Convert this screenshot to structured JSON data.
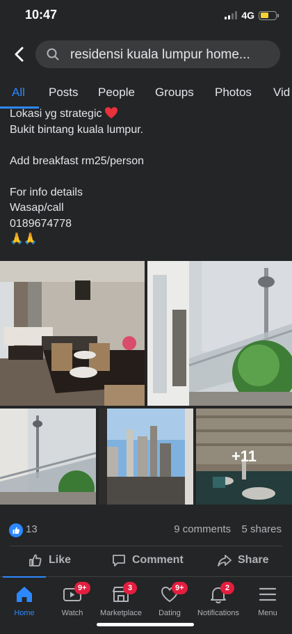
{
  "status_bar": {
    "time": "10:47",
    "network": "4G"
  },
  "search": {
    "query": "residensi kuala lumpur home..."
  },
  "tabs": [
    {
      "label": "All",
      "active": true
    },
    {
      "label": "Posts"
    },
    {
      "label": "People"
    },
    {
      "label": "Groups"
    },
    {
      "label": "Photos"
    },
    {
      "label": "Vid"
    }
  ],
  "post": {
    "lines": [
      "Lokasi yg strategic",
      "Bukit bintang kuala lumpur.",
      "",
      "Add breakfast rm25/person",
      "",
      "For info details",
      "Wasap/call",
      "0189674778",
      "🙏🙏"
    ],
    "more_photos": "+11",
    "reaction_count": "13",
    "comments": "9 comments",
    "shares": "5 shares"
  },
  "actions": {
    "like": "Like",
    "comment": "Comment",
    "share": "Share"
  },
  "bottom_nav": [
    {
      "label": "Home",
      "icon": "home-icon",
      "active": true,
      "badge": ""
    },
    {
      "label": "Watch",
      "icon": "watch-icon",
      "badge": "9+"
    },
    {
      "label": "Marketplace",
      "icon": "marketplace-icon",
      "badge": "3"
    },
    {
      "label": "Dating",
      "icon": "dating-icon",
      "badge": "9+"
    },
    {
      "label": "Notifications",
      "icon": "bell-icon",
      "badge": "2"
    },
    {
      "label": "Menu",
      "icon": "menu-icon",
      "badge": ""
    }
  ],
  "colors": {
    "accent": "#2d88ff",
    "background": "#242526",
    "badge": "#e41e3f"
  }
}
